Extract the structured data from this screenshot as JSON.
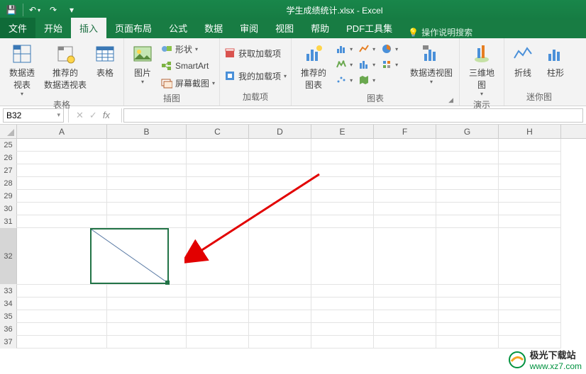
{
  "titlebar": {
    "doc_title": "学生成绩统计.xlsx  -  Excel",
    "qat": {
      "save": "💾",
      "undo": "↶",
      "redo": "↷",
      "more": "▾"
    }
  },
  "tabs": {
    "file": "文件",
    "home": "开始",
    "insert": "插入",
    "pagelayout": "页面布局",
    "formulas": "公式",
    "data": "数据",
    "review": "审阅",
    "view": "视图",
    "help": "帮助",
    "pdf": "PDF工具集",
    "tellme": "操作说明搜索"
  },
  "ribbon": {
    "tables": {
      "pivot": "数据透\n视表",
      "recommended": "推荐的\n数据透视表",
      "table": "表格",
      "group_label": "表格"
    },
    "illustrations": {
      "picture": "图片",
      "shapes": "形状",
      "smartart": "SmartArt",
      "screenshot": "屏幕截图",
      "group_label": "插图"
    },
    "addins": {
      "get": "获取加载项",
      "my": "我的加载项",
      "group_label": "加载项"
    },
    "charts": {
      "recommended": "推荐的\n图表",
      "pivotchart": "数据透视图",
      "group_label": "图表"
    },
    "tours": {
      "map3d": "三维地\n图",
      "group_label": "演示"
    },
    "sparklines": {
      "line": "折线",
      "column": "柱形",
      "group_label": "迷你图"
    }
  },
  "namebox": {
    "value": "B32",
    "drop": "▾"
  },
  "fx": {
    "cancel": "✕",
    "enter": "✓",
    "fx": "fx"
  },
  "cols": [
    "A",
    "B",
    "C",
    "D",
    "E",
    "F",
    "G",
    "H"
  ],
  "rows": [
    "25",
    "26",
    "27",
    "28",
    "29",
    "30",
    "31",
    "32",
    "33",
    "34",
    "35",
    "36",
    "37"
  ],
  "bigrow": "32",
  "watermark": {
    "cn": "极光下载站",
    "url": "www.xz7.com"
  },
  "colwidth_default": 88,
  "colwidth_first": 127,
  "colwidth_b": 112
}
